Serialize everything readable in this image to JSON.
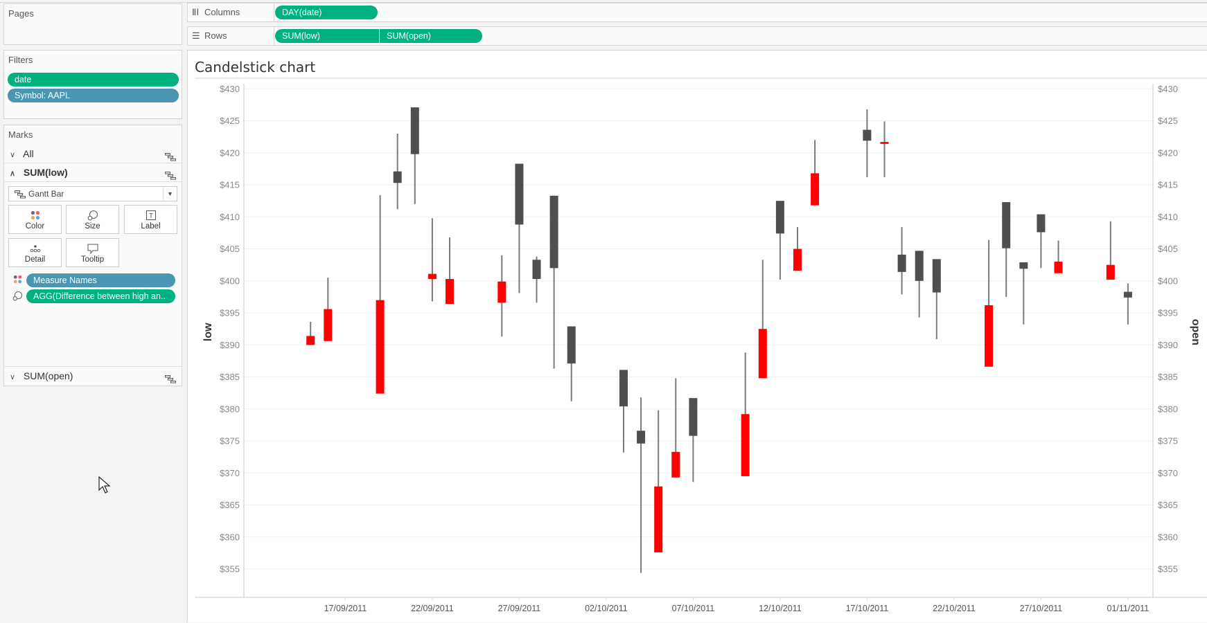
{
  "pages_panel": {
    "title": "Pages"
  },
  "filters_panel": {
    "title": "Filters",
    "pills": [
      {
        "label": "date",
        "color": "green"
      },
      {
        "label": "Symbol: AAPL",
        "color": "blue"
      }
    ]
  },
  "marks_panel": {
    "title": "Marks",
    "cards": [
      {
        "label": "All",
        "expanded": false
      },
      {
        "label": "SUM(low)",
        "expanded": true
      },
      {
        "label": "SUM(open)",
        "expanded": false
      }
    ],
    "mark_type": "Gantt Bar",
    "buttons": [
      "Color",
      "Size",
      "Label",
      "Detail",
      "Tooltip"
    ],
    "fields": [
      {
        "label": "Measure Names",
        "encoding": "color",
        "pill_color": "blue"
      },
      {
        "label": "AGG(Difference between high an..",
        "encoding": "size",
        "pill_color": "green"
      }
    ]
  },
  "shelves": {
    "columns": {
      "label": "Columns",
      "pills": [
        "DAY(date)"
      ]
    },
    "rows": {
      "label": "Rows",
      "pills": [
        "SUM(low)",
        "SUM(open)"
      ]
    }
  },
  "colors": {
    "up_candle": "#4f4f4f",
    "down_candle": "#ff0000",
    "wick": "#7a7a7a",
    "pill_green": "#00b180",
    "pill_blue": "#4996b2"
  },
  "chart_data": {
    "type": "candlestick",
    "title": "Candelstick chart",
    "xlabel": "",
    "ylabel_left": "low",
    "ylabel_right": "open",
    "ylim": [
      351,
      430
    ],
    "yticks": [
      430,
      425,
      420,
      415,
      410,
      405,
      400,
      395,
      390,
      385,
      380,
      375,
      370,
      365,
      360,
      355
    ],
    "ytick_labels": [
      "$430",
      "$425",
      "$420",
      "$415",
      "$410",
      "$405",
      "$400",
      "$395",
      "$390",
      "$385",
      "$380",
      "$375",
      "$370",
      "$365",
      "$360",
      "$355"
    ],
    "xticks": [
      "17/09/2011",
      "22/09/2011",
      "27/09/2011",
      "02/10/2011",
      "07/10/2011",
      "12/10/2011",
      "17/10/2011",
      "22/10/2011",
      "27/10/2011",
      "01/11/2011"
    ],
    "xrange_days": [
      "2011-09-13",
      "2011-11-03"
    ],
    "grid": true,
    "candles": [
      {
        "date": "2011-09-15",
        "body_top": 391.4,
        "body_bottom": 390.0,
        "high": 393.6,
        "low": 390.0,
        "direction": "down"
      },
      {
        "date": "2011-09-16",
        "body_top": 395.6,
        "body_bottom": 390.6,
        "high": 400.5,
        "low": 390.6,
        "direction": "down"
      },
      {
        "date": "2011-09-19",
        "body_top": 397.0,
        "body_bottom": 382.4,
        "high": 413.4,
        "low": 382.4,
        "direction": "down"
      },
      {
        "date": "2011-09-20",
        "body_top": 417.1,
        "body_bottom": 415.3,
        "high": 423.0,
        "low": 411.2,
        "direction": "up"
      },
      {
        "date": "2011-09-21",
        "body_top": 427.1,
        "body_bottom": 419.8,
        "high": 427.1,
        "low": 412.0,
        "direction": "up"
      },
      {
        "date": "2011-09-22",
        "body_top": 401.1,
        "body_bottom": 400.3,
        "high": 409.8,
        "low": 396.8,
        "direction": "down"
      },
      {
        "date": "2011-09-23",
        "body_top": 400.3,
        "body_bottom": 396.4,
        "high": 406.8,
        "low": 396.4,
        "direction": "down"
      },
      {
        "date": "2011-09-26",
        "body_top": 399.9,
        "body_bottom": 396.6,
        "high": 404.0,
        "low": 391.3,
        "direction": "down"
      },
      {
        "date": "2011-09-27",
        "body_top": 418.3,
        "body_bottom": 408.8,
        "high": 418.3,
        "low": 398.1,
        "direction": "up"
      },
      {
        "date": "2011-09-28",
        "body_top": 403.3,
        "body_bottom": 400.3,
        "high": 403.8,
        "low": 396.6,
        "direction": "up"
      },
      {
        "date": "2011-09-29",
        "body_top": 413.3,
        "body_bottom": 402.0,
        "high": 413.3,
        "low": 386.3,
        "direction": "up"
      },
      {
        "date": "2011-09-30",
        "body_top": 392.9,
        "body_bottom": 387.1,
        "high": 392.9,
        "low": 381.2,
        "direction": "up"
      },
      {
        "date": "2011-10-03",
        "body_top": 386.1,
        "body_bottom": 380.4,
        "high": 386.1,
        "low": 373.2,
        "direction": "up"
      },
      {
        "date": "2011-10-04",
        "body_top": 376.6,
        "body_bottom": 374.6,
        "high": 381.8,
        "low": 354.4,
        "direction": "up"
      },
      {
        "date": "2011-10-05",
        "body_top": 367.9,
        "body_bottom": 357.6,
        "high": 379.8,
        "low": 357.6,
        "direction": "down"
      },
      {
        "date": "2011-10-06",
        "body_top": 373.3,
        "body_bottom": 369.3,
        "high": 384.8,
        "low": 369.3,
        "direction": "down"
      },
      {
        "date": "2011-10-07",
        "body_top": 381.7,
        "body_bottom": 375.8,
        "high": 381.7,
        "low": 368.6,
        "direction": "up"
      },
      {
        "date": "2011-10-10",
        "body_top": 379.2,
        "body_bottom": 369.5,
        "high": 388.8,
        "low": 369.5,
        "direction": "down"
      },
      {
        "date": "2011-10-11",
        "body_top": 392.5,
        "body_bottom": 384.8,
        "high": 403.3,
        "low": 384.8,
        "direction": "down"
      },
      {
        "date": "2011-10-12",
        "body_top": 412.5,
        "body_bottom": 407.4,
        "high": 412.5,
        "low": 400.2,
        "direction": "up"
      },
      {
        "date": "2011-10-13",
        "body_top": 405.0,
        "body_bottom": 401.6,
        "high": 408.4,
        "low": 401.6,
        "direction": "down"
      },
      {
        "date": "2011-10-14",
        "body_top": 416.8,
        "body_bottom": 411.8,
        "high": 422.0,
        "low": 411.8,
        "direction": "down"
      },
      {
        "date": "2011-10-17",
        "body_top": 423.6,
        "body_bottom": 421.9,
        "high": 426.8,
        "low": 416.2,
        "direction": "up"
      },
      {
        "date": "2011-10-18",
        "body_top": 421.7,
        "body_bottom": 421.4,
        "high": 424.9,
        "low": 416.2,
        "direction": "down"
      },
      {
        "date": "2011-10-19",
        "body_top": 404.1,
        "body_bottom": 401.4,
        "high": 408.4,
        "low": 397.9,
        "direction": "up"
      },
      {
        "date": "2011-10-20",
        "body_top": 404.7,
        "body_bottom": 400.0,
        "high": 404.7,
        "low": 394.3,
        "direction": "up"
      },
      {
        "date": "2011-10-21",
        "body_top": 403.4,
        "body_bottom": 398.2,
        "high": 403.4,
        "low": 390.9,
        "direction": "up"
      },
      {
        "date": "2011-10-24",
        "body_top": 396.2,
        "body_bottom": 386.6,
        "high": 406.4,
        "low": 386.6,
        "direction": "down"
      },
      {
        "date": "2011-10-25",
        "body_top": 412.3,
        "body_bottom": 405.1,
        "high": 412.3,
        "low": 397.5,
        "direction": "up"
      },
      {
        "date": "2011-10-26",
        "body_top": 402.9,
        "body_bottom": 401.9,
        "high": 402.9,
        "low": 393.2,
        "direction": "up"
      },
      {
        "date": "2011-10-27",
        "body_top": 410.4,
        "body_bottom": 407.6,
        "high": 410.4,
        "low": 402.0,
        "direction": "up"
      },
      {
        "date": "2011-10-28",
        "body_top": 403.0,
        "body_bottom": 401.2,
        "high": 406.3,
        "low": 401.2,
        "direction": "down"
      },
      {
        "date": "2011-10-31",
        "body_top": 402.5,
        "body_bottom": 400.2,
        "high": 409.3,
        "low": 400.2,
        "direction": "down"
      },
      {
        "date": "2011-11-01",
        "body_top": 398.3,
        "body_bottom": 397.4,
        "high": 399.6,
        "low": 393.2,
        "direction": "up"
      }
    ]
  }
}
